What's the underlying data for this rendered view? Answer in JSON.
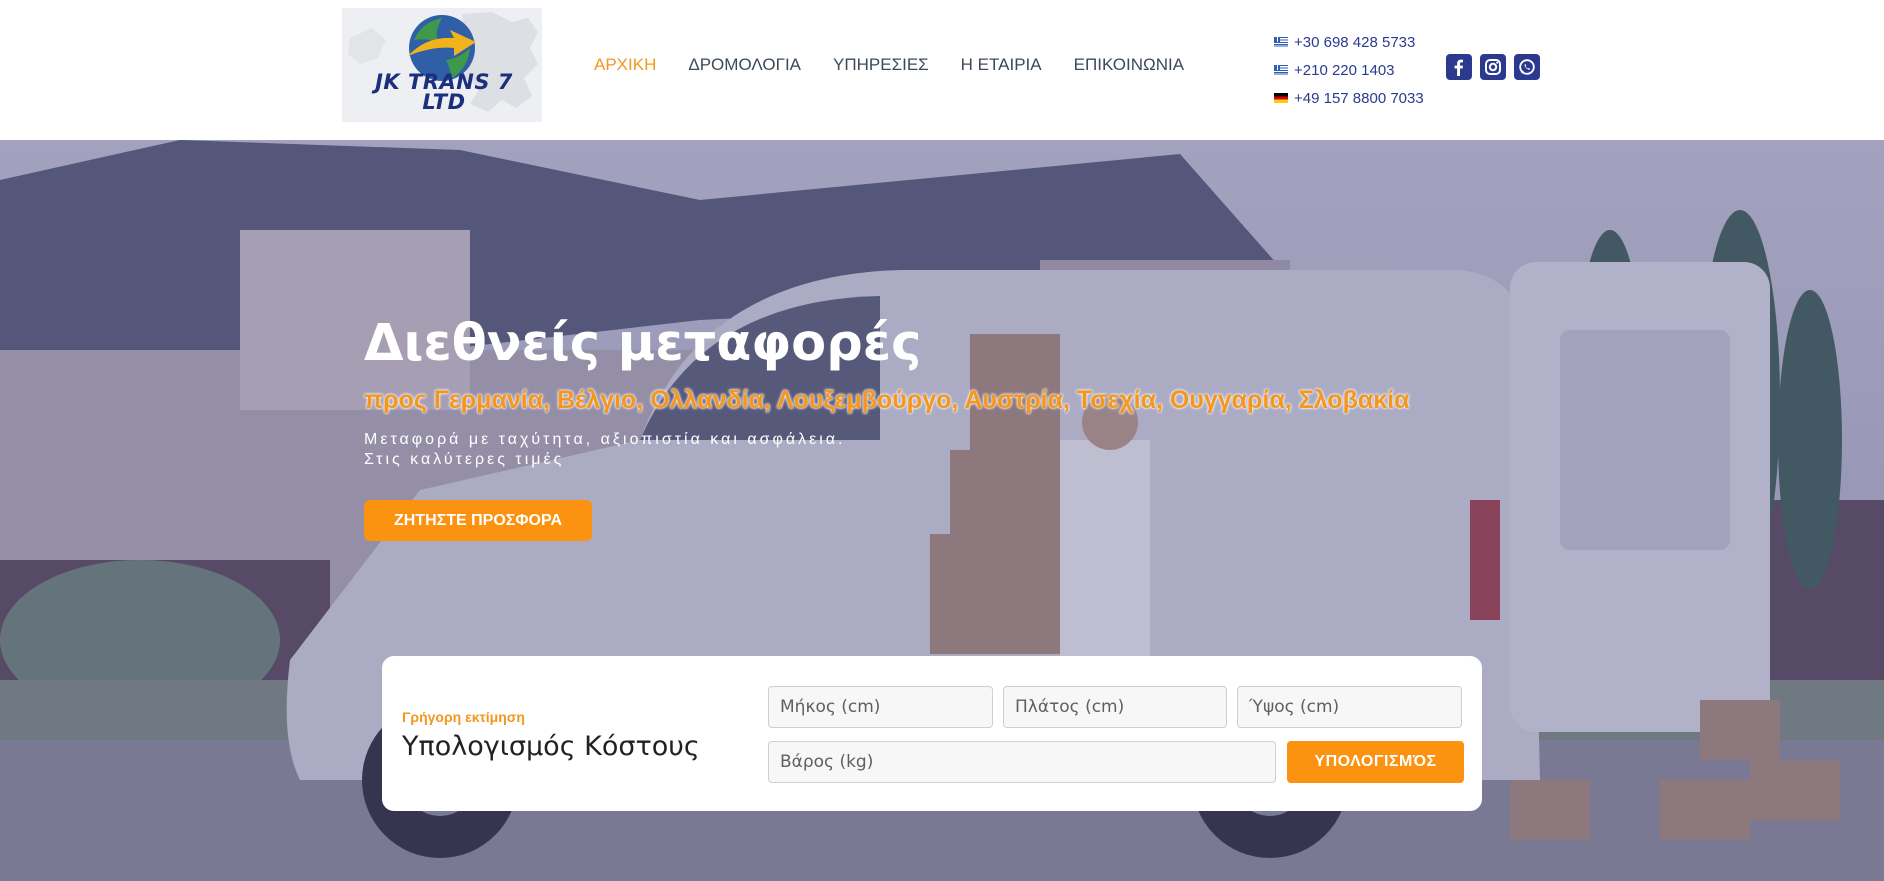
{
  "brand": {
    "logo_line1": "JK TRANS 7",
    "logo_line2": "LTD"
  },
  "nav": {
    "items": [
      {
        "label": "ΑΡΧΙΚΗ",
        "active": true
      },
      {
        "label": "ΔΡΟΜΟΛΟΓΙΑ",
        "active": false
      },
      {
        "label": "ΥΠΗΡΕΣΙΕΣ",
        "active": false
      },
      {
        "label": "Η ΕΤΑΙΡΙΑ",
        "active": false
      },
      {
        "label": "ΕΠΙΚΟΙΝΩΝΙΑ",
        "active": false
      }
    ]
  },
  "contacts": {
    "phones": [
      {
        "flag": "greece-flag",
        "number": "+30 698 428 5733"
      },
      {
        "flag": "greece-flag",
        "number": "+210 220 1403"
      },
      {
        "flag": "germany-flag",
        "number": "+49 157 8800 7033"
      }
    ],
    "socials": [
      "facebook-icon",
      "instagram-icon",
      "whatsapp-icon"
    ]
  },
  "hero": {
    "title": "Διεθνείς μεταφορές",
    "subtitle": "προς Γερμανία, Βέλγιο, Ολλανδία, Λουξεμβούργο, Αυστρία, Τσεχία, Ουγγαρία, Σλοβακία",
    "text_line1": "Μεταφορά με ταχύτητα, αξιοπιστία και ασφάλεια.",
    "text_line2": "Στις καλύτερες τιμές",
    "cta_label": "ΖΗΤΗΣΤΕ ΠΡΟΣΦΟΡΑ"
  },
  "estimate": {
    "kicker": "Γρήγορη εκτίμηση",
    "title": "Υπολογισμός Κόστους",
    "length_placeholder": "Μήκος (cm)",
    "width_placeholder": "Πλάτος (cm)",
    "height_placeholder": "Ύψος (cm)",
    "weight_placeholder": "Βάρος (kg)",
    "button_label": "ΥΠΟΛΟΓΙΣΜΌΣ"
  },
  "colors": {
    "accent": "#fb9210",
    "brand_blue": "#2b3a8f",
    "nav_text": "#3d4a57"
  }
}
